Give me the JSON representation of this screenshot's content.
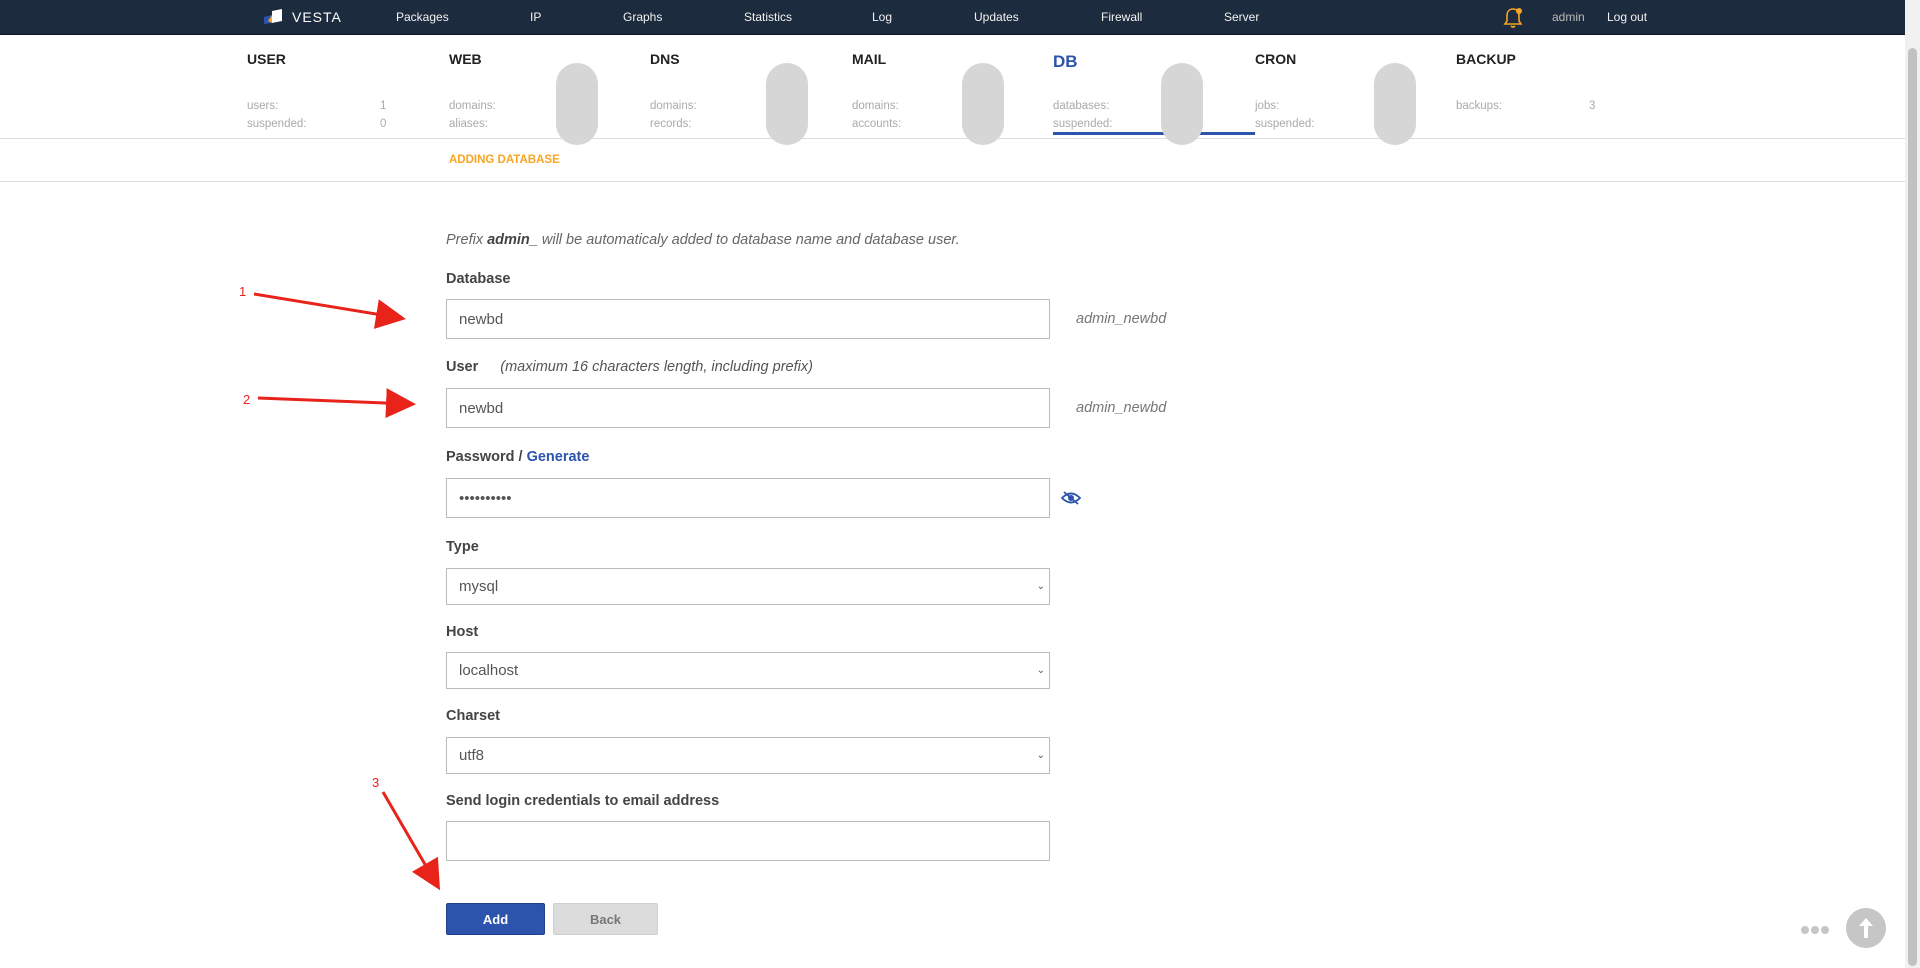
{
  "topnav": {
    "logo_text": "VESTA",
    "items": [
      "Packages",
      "IP",
      "Graphs",
      "Statistics",
      "Log",
      "Updates",
      "Firewall",
      "Server"
    ],
    "user": "admin",
    "logout": "Log out",
    "bell_color": "#f7a522"
  },
  "stats": [
    {
      "title": "USER",
      "lines": [
        {
          "label": "users:",
          "value": "1"
        },
        {
          "label": "suspended:",
          "value": "0"
        }
      ]
    },
    {
      "title": "WEB",
      "lines": [
        {
          "label": "domains:",
          "value": ""
        },
        {
          "label": "aliases:",
          "value": ""
        }
      ]
    },
    {
      "title": "DNS",
      "lines": [
        {
          "label": "domains:",
          "value": ""
        },
        {
          "label": "records:",
          "value": ""
        }
      ]
    },
    {
      "title": "MAIL",
      "lines": [
        {
          "label": "domains:",
          "value": ""
        },
        {
          "label": "accounts:",
          "value": ""
        }
      ]
    },
    {
      "title": "DB",
      "lines": [
        {
          "label": "databases:",
          "value": ""
        },
        {
          "label": "suspended:",
          "value": ""
        }
      ]
    },
    {
      "title": "CRON",
      "lines": [
        {
          "label": "jobs:",
          "value": ""
        },
        {
          "label": "suspended:",
          "value": ""
        }
      ]
    },
    {
      "title": "BACKUP",
      "lines": [
        {
          "label": "backups:",
          "value": "3"
        }
      ]
    }
  ],
  "subheader": {
    "title": "ADDING DATABASE"
  },
  "form": {
    "hint_pre": "Prefix ",
    "hint_prefix": "admin_",
    "hint_post": " will be automaticaly added to database name and database user.",
    "database_label": "Database",
    "database_value": "newbd",
    "database_preview": "admin_newbd",
    "user_label": "User",
    "user_note": "(maximum 16 characters length, including prefix)",
    "user_value": "newbd",
    "user_preview": "admin_newbd",
    "password_label": "Password /",
    "generate_label": "Generate",
    "password_value": "••••••••••",
    "type_label": "Type",
    "type_value": "mysql",
    "host_label": "Host",
    "host_value": "localhost",
    "charset_label": "Charset",
    "charset_value": "utf8",
    "email_label": "Send login credentials to email address",
    "email_value": "",
    "add_button": "Add",
    "back_button": "Back"
  },
  "annotations": [
    "1",
    "2",
    "3"
  ],
  "colors": {
    "accent": "#2c54ac",
    "nav_bg": "#1d2b3e",
    "highlight": "#f7a522",
    "annotation": "#e8231a"
  }
}
